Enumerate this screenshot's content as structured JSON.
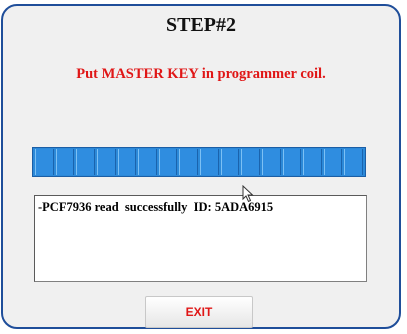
{
  "window": {
    "title": "STEP#2",
    "instruction": "Put MASTER KEY in programmer coil."
  },
  "progress": {
    "fraction": 1.0,
    "segments": 16,
    "color": "#2f8de0"
  },
  "log": {
    "lines": [
      "-PCF7936 read  successfully  ID: 5ADA6915"
    ]
  },
  "buttons": {
    "exit_label": "EXIT"
  },
  "colors": {
    "accent_red": "#e01616",
    "frame_blue": "#1f4e9a"
  },
  "icons": {
    "cursor": "mouse-pointer-icon"
  }
}
